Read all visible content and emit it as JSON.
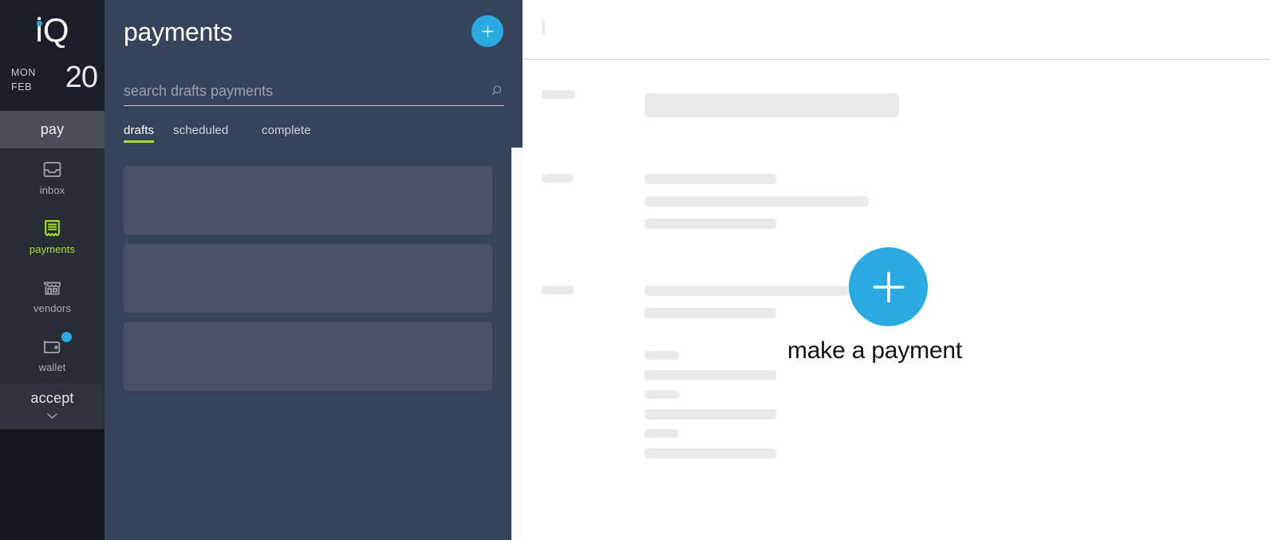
{
  "brand": {
    "logo_text": "iQ",
    "logo_dot_color": "#29ABE2",
    "date_day_of_week": "MON",
    "date_month": "FEB",
    "date_day": "20"
  },
  "rail": {
    "pay_tab_label": "pay",
    "accept_tab_label": "accept",
    "accept_chevron_icon": "chevron-down-icon",
    "items": [
      {
        "label": "inbox",
        "icon": "inbox-icon",
        "active": false,
        "badge": false
      },
      {
        "label": "payments",
        "icon": "receipt-icon",
        "active": true,
        "badge": false
      },
      {
        "label": "vendors",
        "icon": "storefront-icon",
        "active": false,
        "badge": false
      },
      {
        "label": "wallet",
        "icon": "wallet-icon",
        "active": false,
        "badge": true
      }
    ]
  },
  "panel": {
    "title": "payments",
    "add_button_icon": "plus-icon",
    "search": {
      "value": "",
      "placeholder": "search drafts payments",
      "icon": "search-icon"
    },
    "tabs": [
      {
        "label": "drafts",
        "active": true
      },
      {
        "label": "scheduled",
        "active": false
      },
      {
        "label": "complete",
        "active": false
      }
    ],
    "loading_cards": 3
  },
  "main": {
    "loading": true,
    "cta_label": "make a payment",
    "cta_icon": "plus-icon"
  },
  "colors": {
    "accent_blue": "#29ABE2",
    "accent_green": "#A8E02E",
    "rail_dark": "#15191f",
    "rail_nav": "#272c35",
    "panel_blue_gray": "#36435a",
    "skeleton_dark": "#4a5468",
    "skeleton_light": "#eaeaea"
  }
}
